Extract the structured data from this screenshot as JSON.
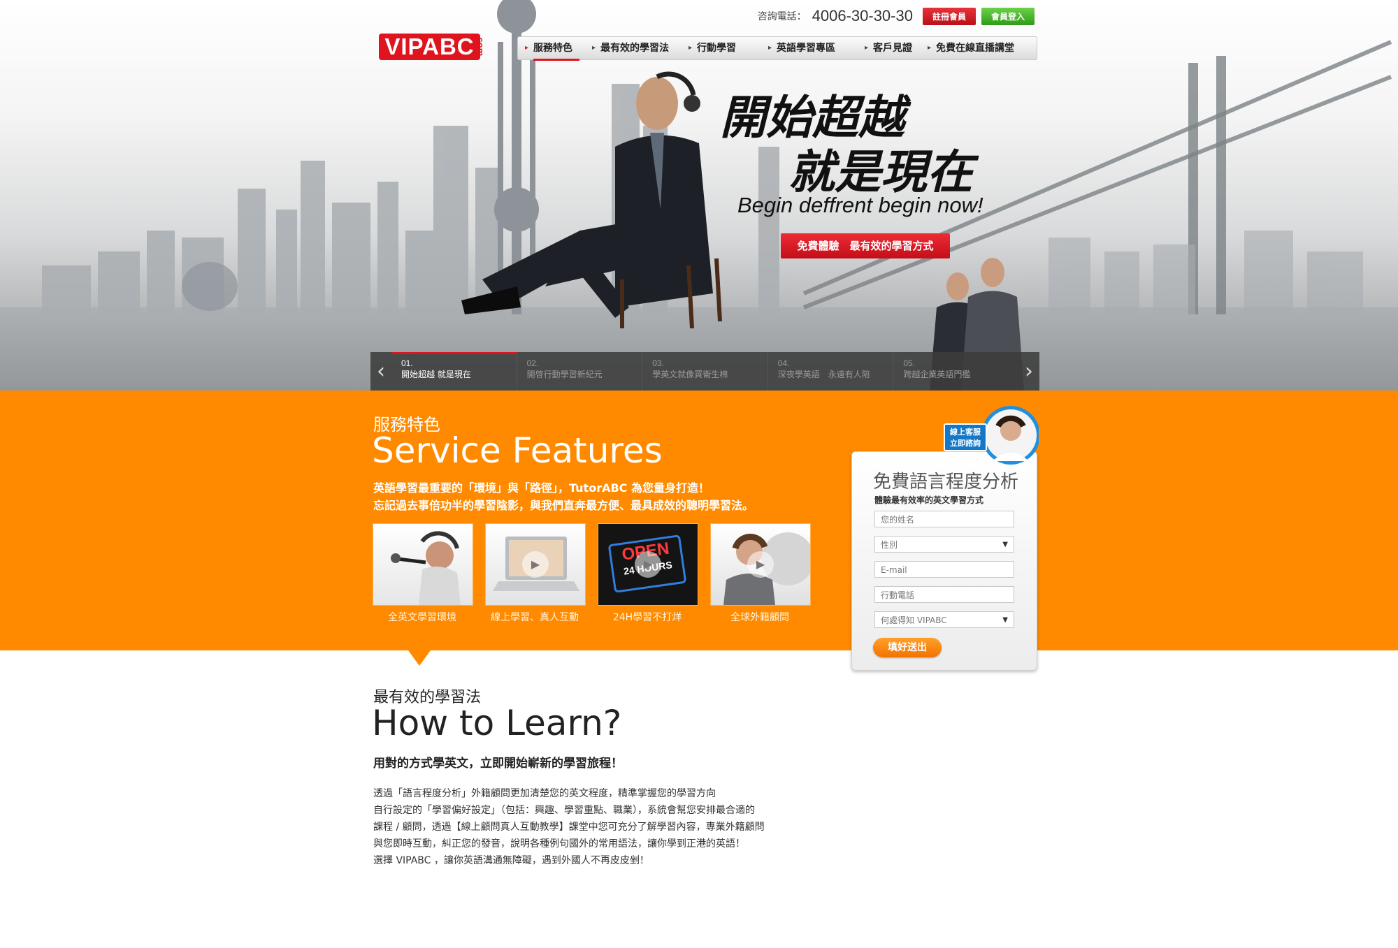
{
  "brand": {
    "logo": "VIPABC",
    "logo_suffix": ".com"
  },
  "header": {
    "phone_label": "咨詢電話：",
    "phone": "4006-30-30-30",
    "register": "註冊會員",
    "login": "會員登入"
  },
  "nav": {
    "items": [
      {
        "label": "服務特色"
      },
      {
        "label": "最有效的學習法"
      },
      {
        "label": "行動學習"
      },
      {
        "label": "英語學習專區"
      },
      {
        "label": "客戶見證"
      },
      {
        "label": "免費在線直播講堂"
      }
    ]
  },
  "hero": {
    "headline_1": "開始超越",
    "headline_2": "就是現在",
    "subline": "Begin deffrent begin now!",
    "cta": "免費體驗　最有效的學習方式"
  },
  "slider": {
    "prev": "‹",
    "next": "›",
    "slides": [
      {
        "num": "01.",
        "text": "開始超越 就是現在"
      },
      {
        "num": "02.",
        "text": "開啓行動學習新紀元"
      },
      {
        "num": "03.",
        "text": "學英文就像買衛生棉"
      },
      {
        "num": "04.",
        "text": "深夜學英語　永遠有人陪"
      },
      {
        "num": "05.",
        "text": "跨越企業英語門檻"
      }
    ]
  },
  "service": {
    "title_zh": "服務特色",
    "title_en": "Service Features",
    "desc_1": "英語學習最重要的「環境」與「路徑」，TutorABC 為您量身打造！",
    "desc_2": "忘記過去事倍功半的學習陰影，與我們直奔最方便、最具成效的聰明學習法。",
    "tiles": [
      {
        "label": "全英文學習環境"
      },
      {
        "label": "線上學習、真人互動"
      },
      {
        "label": "24H學習不打烊",
        "sign_1": "OPEN",
        "sign_2": "24 HOURS"
      },
      {
        "label": "全球外籍顧問"
      }
    ]
  },
  "form": {
    "badge_1": "線上客服",
    "badge_2": "立即諮詢",
    "title": "免費語言程度分析",
    "subtitle": "體驗最有效率的英文學習方式",
    "name_placeholder": "您的姓名",
    "gender": "性別",
    "email_placeholder": "E-mail",
    "mobile_placeholder": "行動電話",
    "source": "何處得知 VIPABC",
    "submit": "填好送出"
  },
  "learn": {
    "title_zh": "最有效的學習法",
    "title_en": "How to Learn?",
    "tagline": "用對的方式學英文，立即開始嶄新的學習旅程！",
    "body": [
      "透過「語言程度分析」外籍顧問更加清楚您的英文程度，精準掌握您的學習方向",
      "自行設定的「學習偏好設定」（包括：興趣、學習重點、職業），系統會幫您安排最合適的",
      "課程 / 顧問，透過【線上顧問真人互動教學】課堂中您可充分了解學習內容，專業外籍顧問",
      "與您即時互動，糾正您的發音，說明各種例句國外的常用語法，讓你學到正港的英語！",
      "選擇 VIPABC ，讓你英語溝通無障礙，遇到外國人不再皮皮剉！"
    ]
  }
}
